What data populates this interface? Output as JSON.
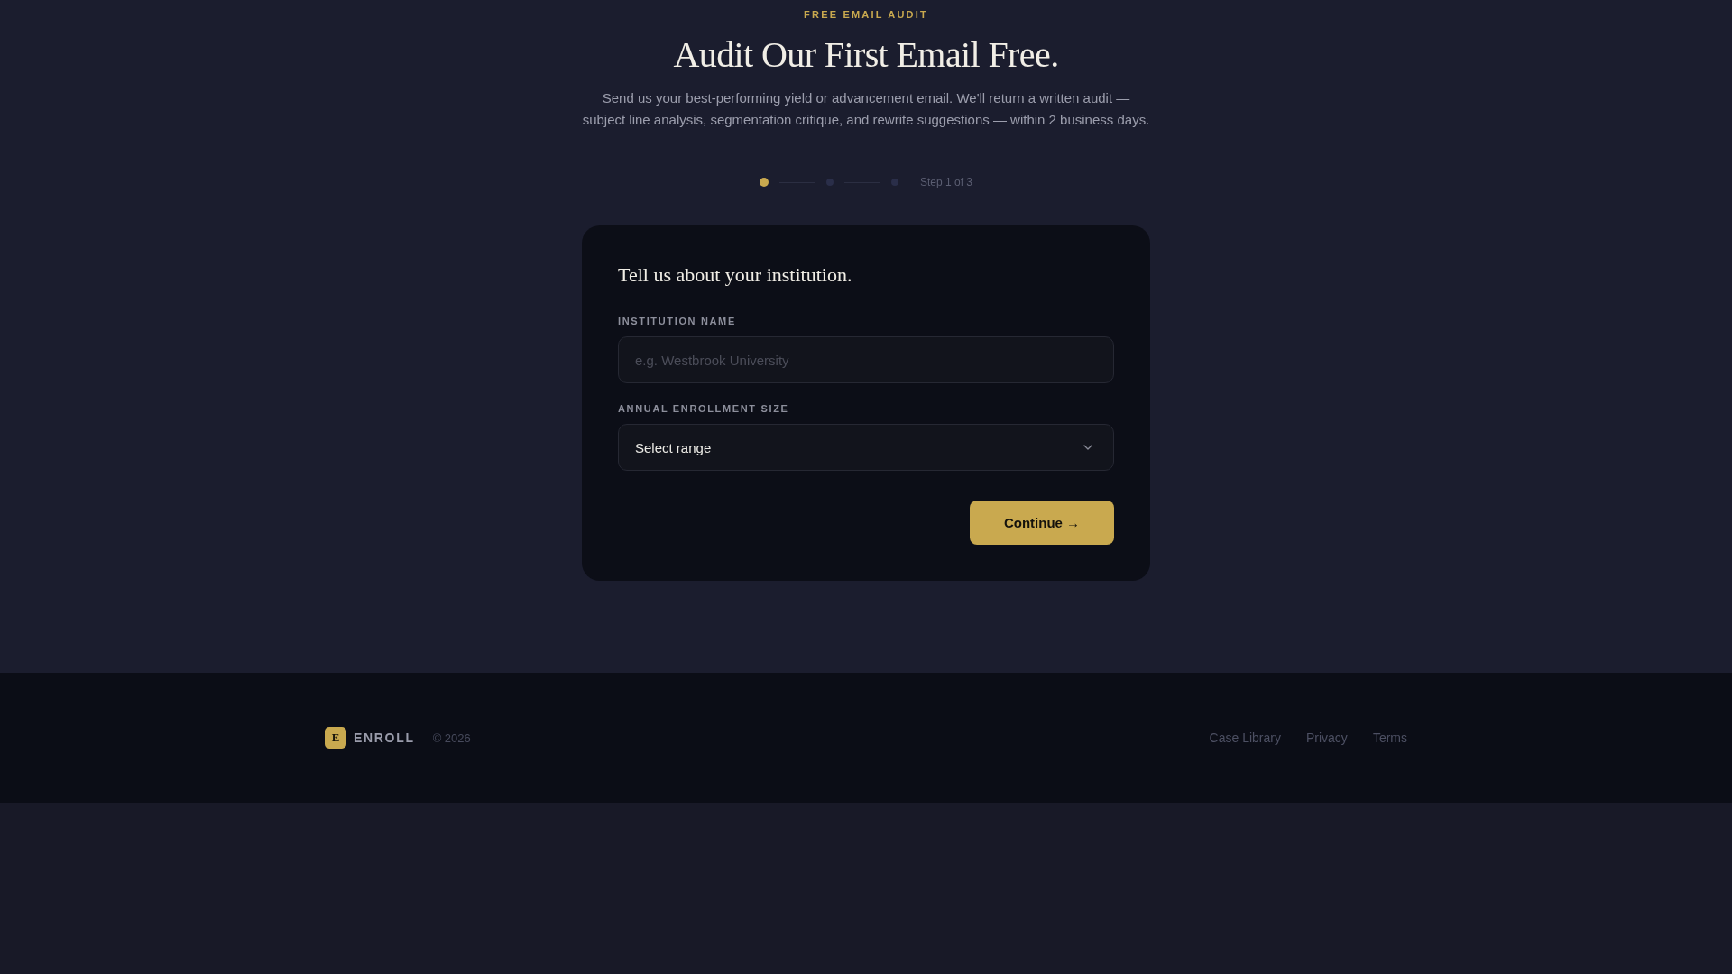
{
  "header": {
    "eyebrow": "FREE EMAIL AUDIT",
    "title": "Audit Our First Email Free.",
    "subtitle": "Send us your best-performing yield or advancement email. We'll return a written audit — subject line analysis, segmentation critique, and rewrite suggestions — within 2 business days."
  },
  "stepper": {
    "steps": [
      {
        "selected": true
      },
      {
        "selected": false
      },
      {
        "selected": false
      }
    ],
    "label": "Step 1 of 3"
  },
  "card": {
    "title": "Tell us about your institution.",
    "fields": [
      {
        "kind": "text",
        "label": "INSTITUTION NAME",
        "placeholder": "e.g. Westbrook University"
      },
      {
        "kind": "select",
        "label": "ANNUAL ENROLLMENT SIZE",
        "value": "Select range"
      }
    ],
    "button": "Continue →"
  },
  "footer": {
    "logo_letter": "E",
    "brand": "ENROLL",
    "copyright": "© 2026",
    "links": [
      "Case Library",
      "Privacy",
      "Terms"
    ]
  }
}
